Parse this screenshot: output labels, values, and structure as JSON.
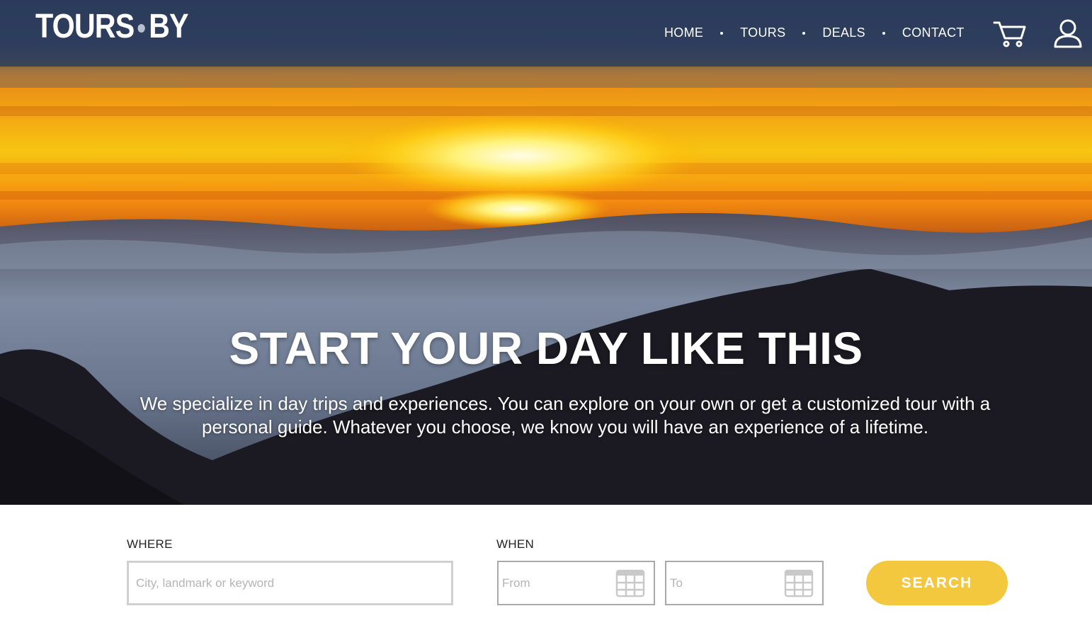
{
  "brand": {
    "logo_left": "TOURS",
    "logo_right": "BY"
  },
  "nav": {
    "items": [
      "HOME",
      "TOURS",
      "DEALS",
      "CONTACT"
    ]
  },
  "icons": {
    "cart": "shopping-cart-icon",
    "account": "user-icon",
    "calendar": "calendar-icon"
  },
  "hero": {
    "headline": "START YOUR DAY LIKE THIS",
    "subtext": "We specialize in day trips and experiences. You can explore on your own or get a customized tour with a personal guide.  Whatever you choose, we know you will have an experience of a lifetime."
  },
  "search": {
    "where_label": "WHERE",
    "where_placeholder": "City, landmark or keyword",
    "when_label": "WHEN",
    "from_placeholder": "From",
    "to_placeholder": "To",
    "button_label": "SEARCH"
  },
  "colors": {
    "header": "#2c3c5c",
    "accent": "#f3c73e"
  }
}
